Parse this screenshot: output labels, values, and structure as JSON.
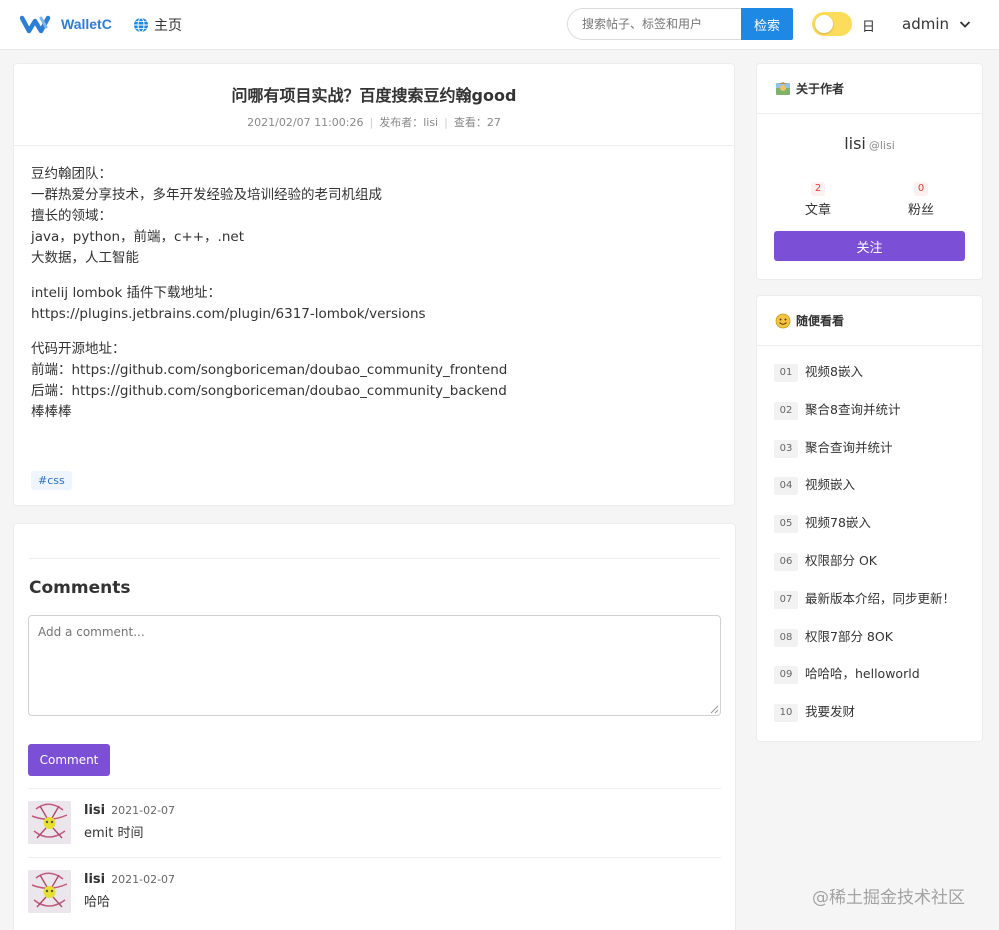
{
  "header": {
    "logo_text": "WalletC",
    "nav_home": "主页",
    "search_placeholder": "搜索帖子、标签和用户",
    "search_button": "检索",
    "theme_label": "日",
    "user": "admin"
  },
  "article": {
    "title": "问哪有项目实战？百度搜索豆约翰good",
    "date": "2021/02/07 11:00:26",
    "author": "发布者：lisi",
    "views": "查看：27",
    "paragraphs": [
      [
        "豆约翰团队：",
        "一群热爱分享技术，多年开发经验及培训经验的老司机组成",
        "擅长的领域：",
        "java，python，前端，c++，.net",
        "大数据，人工智能"
      ],
      [
        "intelij lombok 插件下载地址：",
        "https://plugins.jetbrains.com/plugin/6317-lombok/versions"
      ],
      [
        "代码开源地址：",
        "前端：https://github.com/songboriceman/doubao_community_frontend",
        "后端：https://github.com/songboriceman/doubao_community_backend",
        "棒棒棒"
      ]
    ],
    "tag": "#css"
  },
  "comments": {
    "title": "Comments",
    "placeholder": "Add a comment...",
    "button": "Comment",
    "items": [
      {
        "author": "lisi",
        "date": "2021-02-07",
        "text": "emit 时间"
      },
      {
        "author": "lisi",
        "date": "2021-02-07",
        "text": "哈哈"
      }
    ]
  },
  "author_card": {
    "title": "关于作者",
    "name": "lisi",
    "handle": "@lisi",
    "articles_count": "2",
    "articles_label": "文章",
    "fans_count": "0",
    "fans_label": "粉丝",
    "follow_button": "关注"
  },
  "random_card": {
    "title": "随便看看",
    "items": [
      {
        "num": "01",
        "title": "视频8嵌入"
      },
      {
        "num": "02",
        "title": "聚合8查询并统计"
      },
      {
        "num": "03",
        "title": "聚合查询并统计"
      },
      {
        "num": "04",
        "title": "视频嵌入"
      },
      {
        "num": "05",
        "title": "视频78嵌入"
      },
      {
        "num": "06",
        "title": "权限部分 OK"
      },
      {
        "num": "07",
        "title": "最新版本介绍，同步更新！"
      },
      {
        "num": "08",
        "title": "权限7部分 8OK"
      },
      {
        "num": "09",
        "title": "哈哈哈，helloworld"
      },
      {
        "num": "10",
        "title": "我要发财"
      }
    ]
  },
  "watermark": "@稀土掘金技术社区",
  "colors": {
    "accent_purple": "#7b4fd6",
    "search_blue": "#1e88e5",
    "logo_blue": "#2d7fd6",
    "toggle_yellow": "#fddc5c"
  }
}
